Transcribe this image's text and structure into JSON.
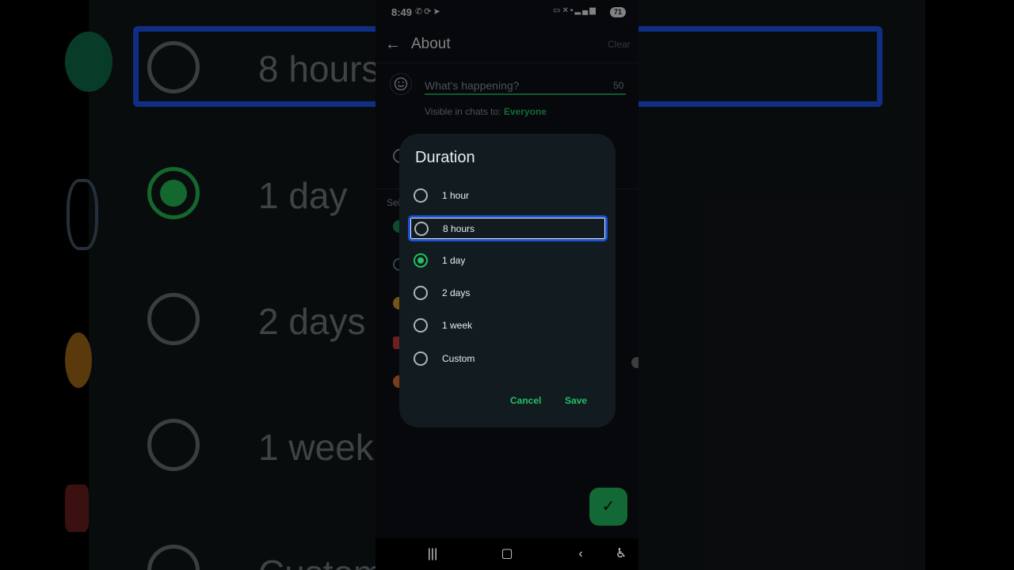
{
  "status_bar": {
    "time": "8:49",
    "left_icons": [
      "whatsapp-icon",
      "sync-icon",
      "telegram-icon"
    ],
    "right_icons": [
      "cast-icon",
      "mute-icon",
      "5g-icon",
      "signal-icon",
      "signal-icon"
    ],
    "battery": "71"
  },
  "app_bar": {
    "title": "About",
    "clear_label": "Clear"
  },
  "about_input": {
    "placeholder": "What's happening?",
    "value": "",
    "char_count": "50"
  },
  "visibility": {
    "label": "Visible in chats to:",
    "value": "Everyone"
  },
  "dialog": {
    "title": "Duration",
    "options": [
      {
        "label": "1 hour",
        "selected": false,
        "focused": false
      },
      {
        "label": "8 hours",
        "selected": false,
        "focused": true
      },
      {
        "label": "1 day",
        "selected": true,
        "focused": false
      },
      {
        "label": "2 days",
        "selected": false,
        "focused": false
      },
      {
        "label": "1 week",
        "selected": false,
        "focused": false
      },
      {
        "label": "Custom",
        "selected": false,
        "focused": false
      }
    ],
    "cancel_label": "Cancel",
    "save_label": "Save"
  },
  "background_zoom": {
    "options": [
      "8 hours",
      "1 day",
      "2 days",
      "1 week",
      "Custom"
    ]
  },
  "partial_section_label": "Sel",
  "colors": {
    "accent": "#21c063",
    "focus_ring": "#1a52d8",
    "dialog_bg": "#121b20",
    "screen_bg": "#0b1014"
  }
}
